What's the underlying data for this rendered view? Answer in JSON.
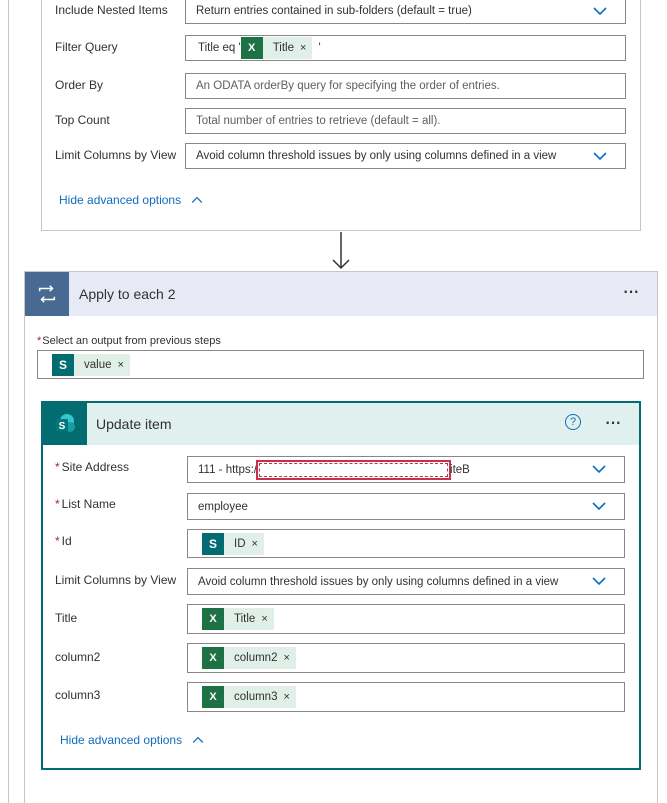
{
  "top_card": {
    "fields": [
      {
        "label": "Include Nested Items",
        "value": "Return entries contained in sub-folders (default = true)",
        "dropdown": true
      },
      {
        "label": "Filter Query",
        "prefix": "Title eq '",
        "token": "Title",
        "suffix": "'"
      },
      {
        "label": "Order By",
        "value": "An ODATA orderBy query for specifying the order of entries."
      },
      {
        "label": "Top Count",
        "value": "Total number of entries to retrieve (default = all)."
      },
      {
        "label": "Limit Columns by View",
        "value": "Avoid column threshold issues by only using columns defined in a view",
        "dropdown": true
      }
    ],
    "hide_advanced": "Hide advanced options"
  },
  "apply_each": {
    "title": "Apply to each 2",
    "more": "···",
    "select_label": "Select an output from previous steps",
    "required_mark": "*",
    "token": "value",
    "token_close": "×"
  },
  "update_item": {
    "title": "Update item",
    "help": "?",
    "more": "···",
    "fields": [
      {
        "label": "Site Address",
        "required": true,
        "value_start": "111 - https:/",
        "value_end": "iteB"
      },
      {
        "label": "List Name",
        "required": true,
        "value": "employee"
      },
      {
        "label": "Id",
        "required": true,
        "token": "ID"
      },
      {
        "label": "Limit Columns by View",
        "value": "Avoid column threshold issues by only using columns defined in a view"
      },
      {
        "label": "Title",
        "token": "Title"
      },
      {
        "label": "column2",
        "token": "column2"
      },
      {
        "label": "column3",
        "token": "column3"
      }
    ],
    "hide_advanced": "Hide advanced options"
  },
  "colors": {
    "accent_link": "#0f6cbd",
    "loop_header_bg": "#e7e9f4",
    "loop_icon_bg": "#486991",
    "sp_header_bg": "#e0f0ee",
    "sp_border": "#036c70",
    "excel_green": "#1e7145",
    "token_bg": "#e1efe9"
  }
}
